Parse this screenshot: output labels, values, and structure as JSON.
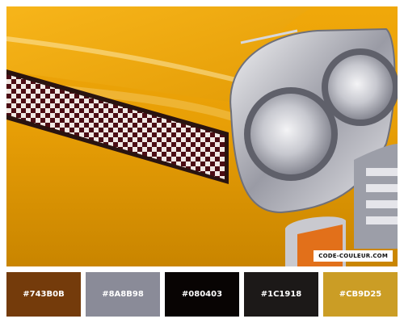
{
  "watermark": {
    "text": "CODE-COULEUR.COM"
  },
  "palette": [
    {
      "label": "#743B0B",
      "color": "#743B0B"
    },
    {
      "label": "#8A8B98",
      "color": "#8A8B98"
    },
    {
      "label": "#080403",
      "color": "#080403"
    },
    {
      "label": "#1C1918",
      "color": "#1C1918"
    },
    {
      "label": "#CB9D25",
      "color": "#CB9D25"
    }
  ]
}
